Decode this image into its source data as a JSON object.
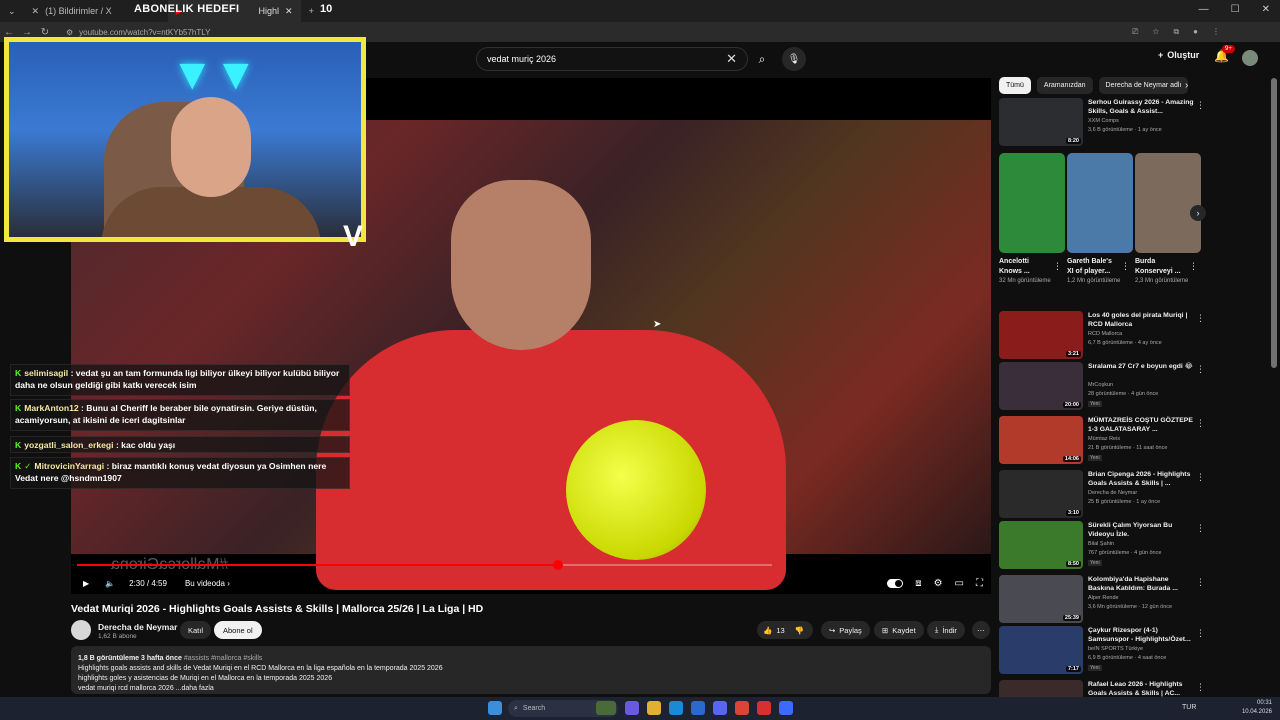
{
  "browser": {
    "tab1": "(1) Bildirimler / X",
    "tab2": "Highl",
    "overlay_banner": "ABONELIK HEDEFI",
    "overlay_count": "10",
    "url": "youtube.com/watch?v=ntKYb57hTLY"
  },
  "header": {
    "search_value": "vedat muriç 2026",
    "create_label": "Oluştur",
    "notif_badge": "9+"
  },
  "player": {
    "watermark": "#MallorcaGirona",
    "time": "2:30 / 4:59",
    "chapter": "Bu videoda",
    "progress": 0.526,
    "buffered": 0.76
  },
  "chat": [
    {
      "user": "selimisagil",
      "msg": ": vedat şu an tam formunda ligi biliyor ülkeyi biliyor kulübü biliyor daha ne olsun geldiği gibi katkı verecek isim"
    },
    {
      "user": "MarkAnton12",
      "msg": ": Bunu al Cheriff le beraber bile oynatirsin. Geriye düstün, acamiyorsun, at ikisini de iceri dagitsinlar"
    },
    {
      "user": "yozgatli_salon_erkegi",
      "msg": ": kac oldu yaşı"
    },
    {
      "user": "MitrovicinYarragi",
      "msg": ": biraz mantıklı konuş vedat diyosun ya Osimhen nere Vedat nere @hsndmn1907"
    }
  ],
  "video": {
    "title": "Vedat Muriqi 2026 - Highlights Goals Assists & Skills | Mallorca 25/26 | La Liga | HD",
    "channel": "Derecha de Neymar",
    "subs": "1,62 B abone",
    "join": "Katıl",
    "subscribe": "Abone ol",
    "likes": "13",
    "share": "Paylaş",
    "save": "Kaydet",
    "download": "İndir",
    "desc_meta": "1,8 B görüntüleme  3 hafta önce",
    "desc_tags": "#assists #mallorca #skills",
    "desc_line1": "Highlights goals assists and skills de Vedat Muriqi en el RCD Mallorca en la liga española en la temporada 2025 2026",
    "desc_line2": "highlights goles y asistencias de Muriqi en el Mallorca en la temporada 2025 2026",
    "desc_line3": "vedat muriqi rcd mallorca 2026 ...daha fazla"
  },
  "chips": [
    "Tümü",
    "Aramanızdan",
    "Derecha de Neymar adlı"
  ],
  "sidebar_top": {
    "title": "Serhou Guirassy 2026 - Amazing Skills, Goals & Assist...",
    "channel": "XXM Comps",
    "stats": "3,6 B görüntüleme · 1 ay önce",
    "duration": "8:20",
    "color": "#2c2d31"
  },
  "shorts": [
    {
      "title": "Ancelotti Knows ...",
      "views": "32 Mn görüntüleme",
      "color": "#2c8a3a"
    },
    {
      "title": "Gareth Bale's XI of player...",
      "views": "1,2 Mn görüntüleme",
      "color": "#4c7aa8"
    },
    {
      "title": "Burda Konserveyi ...",
      "views": "2,3 Mn görüntüleme",
      "color": "#7c6a5c"
    }
  ],
  "sidebar": [
    {
      "title": "Los 40 goles del pirata Muriqi | RCD Mallorca",
      "channel": "RCD Mallorca",
      "stats": "6,7 B görüntüleme · 4 ay önce",
      "duration": "3:21",
      "new": "",
      "color": "#8a1c1c"
    },
    {
      "title": "Sıralama 27 Cr7 e boyun egdi 😂",
      "channel": "MrCoşkun",
      "stats": "28 görüntüleme · 4 gün önce",
      "duration": "20:00",
      "new": "Yeni",
      "color": "#3a2e3a"
    },
    {
      "title": "MÜMTAZREİS COŞTU GÖZTEPE 1-3 GALATASARAY ...",
      "channel": "Mümtaz Reis",
      "stats": "21 B görüntüleme · 11 saat önce",
      "duration": "14:06",
      "new": "Yeni",
      "color": "#b23a2a"
    },
    {
      "title": "Brian Cipenga 2026 - Highlights Goals Assists & Skills | ...",
      "channel": "Derecha de Neymar",
      "stats": "25 B görüntüleme · 1 ay önce",
      "duration": "3:10",
      "new": "",
      "color": "#2a2a2a"
    },
    {
      "title": "Sürekli Çalım Yiyorsan Bu Videoyu İzle.",
      "channel": "Bilal Şahin",
      "stats": "767 görüntüleme · 4 gün önce",
      "duration": "8:50",
      "new": "Yeni",
      "color": "#3a7a2a"
    },
    {
      "title": "Kolombiya'da Hapishane Baskına Katıldım: Burada ...",
      "channel": "Alper Rende",
      "stats": "3,6 Mn görüntüleme · 12 gün önce",
      "duration": "25:39",
      "new": "",
      "color": "#4a4a52"
    },
    {
      "title": "Çaykur Rizespor (4-1) Samsunspor - Highlights/Özet...",
      "channel": "beIN SPORTS Türkiye",
      "stats": "6,9 B görüntüleme · 4 saat önce",
      "duration": "7:17",
      "new": "Yeni",
      "color": "#2a3c6a"
    },
    {
      "title": "Rafael Leao 2026 - Highlights Goals Assists & Skills | AC...",
      "channel": "",
      "stats": "",
      "duration": "",
      "new": "",
      "color": "#3a2a2a"
    }
  ],
  "taskbar": {
    "search": "Search",
    "lang": "TUR",
    "time": "00:31",
    "date": "10.04.2026"
  }
}
